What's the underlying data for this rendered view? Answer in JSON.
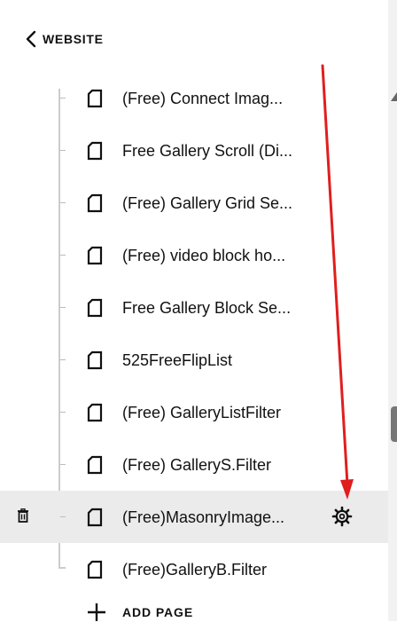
{
  "header": {
    "back_icon": "chevron-left-icon",
    "title": "WEBSITE"
  },
  "pages": [
    {
      "label": "(Free) Connect Imag...",
      "icon": "page-icon"
    },
    {
      "label": "Free Gallery Scroll (Di...",
      "icon": "page-icon"
    },
    {
      "label": "(Free) Gallery Grid Se...",
      "icon": "page-icon"
    },
    {
      "label": "(Free) video block ho...",
      "icon": "page-icon"
    },
    {
      "label": "Free Gallery Block Se...",
      "icon": "page-icon"
    },
    {
      "label": "525FreeFlipList",
      "icon": "page-icon"
    },
    {
      "label": "(Free) GalleryListFilter",
      "icon": "page-icon"
    },
    {
      "label": "(Free) GalleryS.Filter",
      "icon": "page-icon"
    },
    {
      "label": "(Free)MasonryImage...",
      "icon": "page-icon",
      "selected": true,
      "actions": [
        "trash-icon",
        "gear-icon"
      ]
    },
    {
      "label": "(Free)GalleryB.Filter",
      "icon": "page-icon"
    }
  ],
  "add_page": {
    "icon": "plus-icon",
    "label": "ADD PAGE"
  },
  "annotation": {
    "icon": "red-arrow",
    "color": "#e01e1e"
  },
  "colors": {
    "selected_row": "#ebebeb",
    "tree_line": "#cccccc"
  }
}
